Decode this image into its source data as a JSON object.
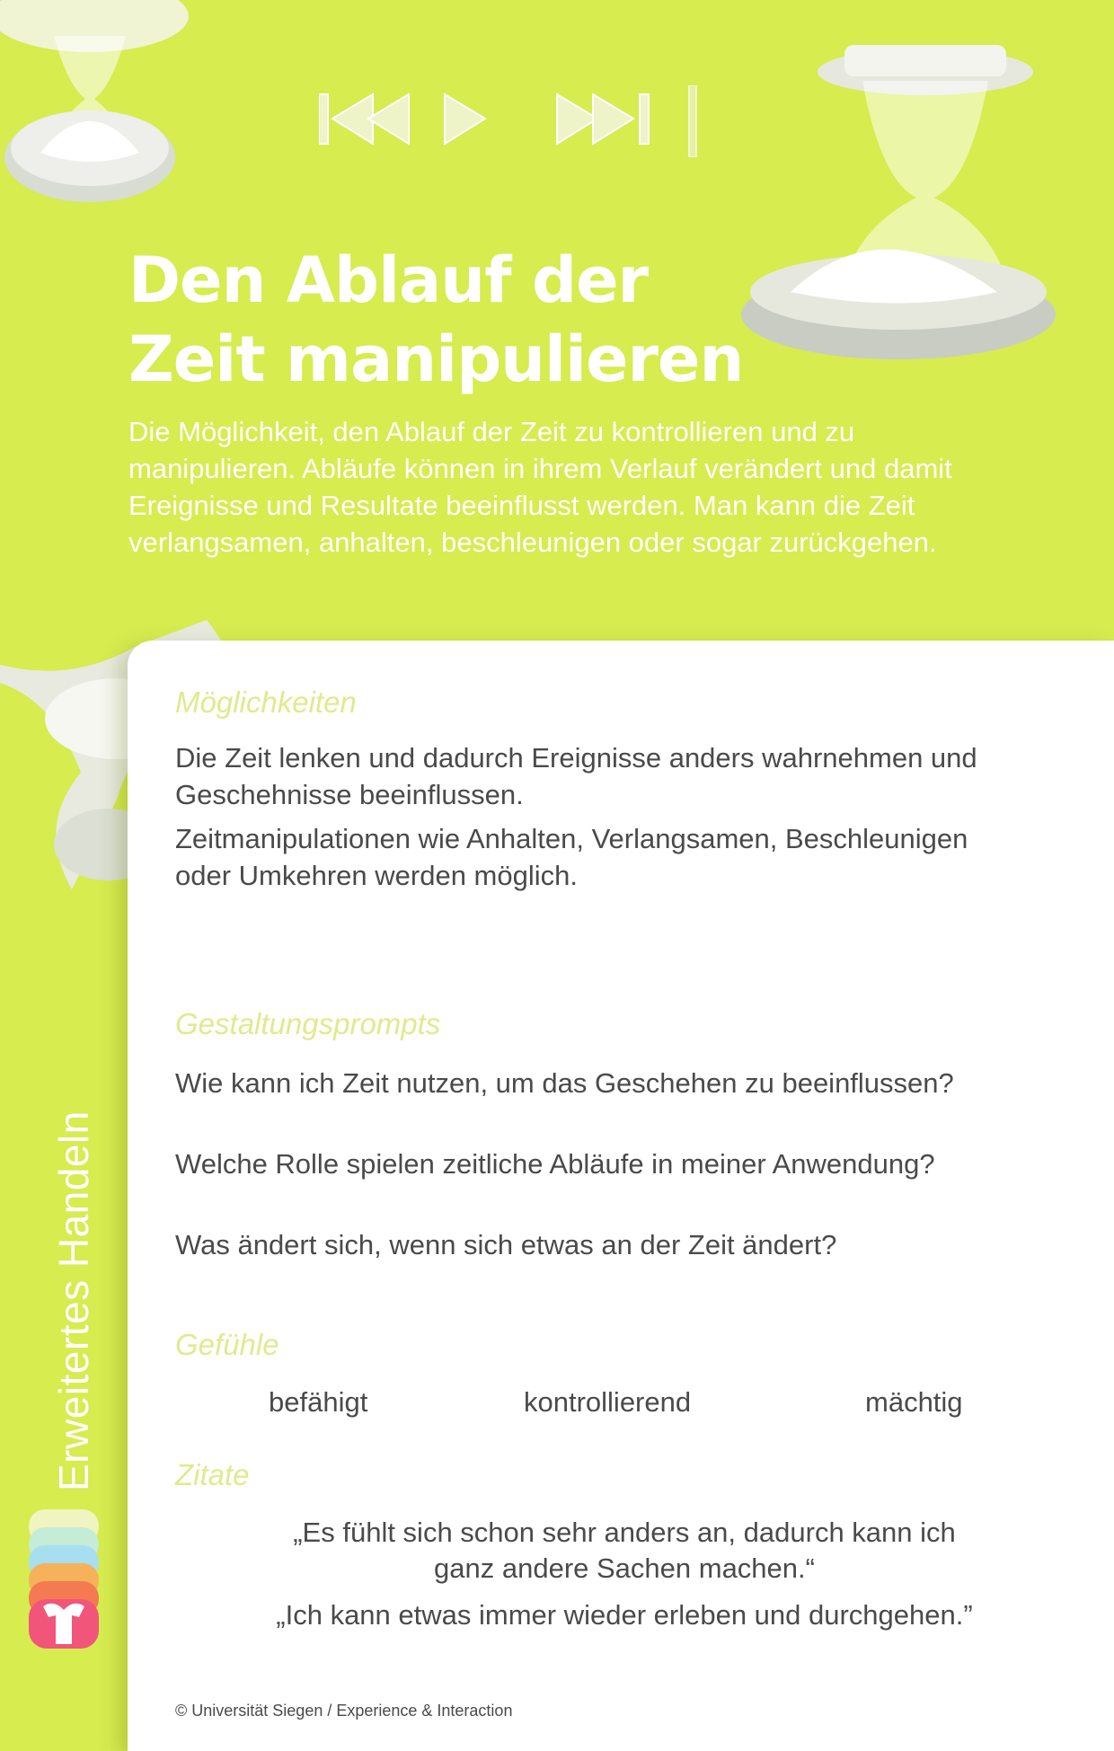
{
  "header": {
    "title_line1": "Den Ablauf der",
    "title_line2": "Zeit manipulieren",
    "intro_lines": [
      "Die Möglichkeit, den Ablauf der Zeit zu kontrollieren und zu",
      "manipulieren. Abläufe können in ihrem Verlauf verändert und damit",
      "Ereignisse und Resultate beeinflusst werden. Man kann die Zeit",
      "verlangsamen, anhalten, beschleunigen oder sogar zurückgehen."
    ]
  },
  "side_label": "Erweitertes Handeln",
  "sections": {
    "moeglichkeiten": {
      "heading": "Möglichkeiten",
      "p1_lines": [
        "Die Zeit lenken und dadurch Ereignisse anders wahrnehmen und",
        "Geschehnisse beeinflussen."
      ],
      "p2_lines": [
        "Zeitmanipulationen wie Anhalten, Verlangsamen, Beschleunigen",
        "oder Umkehren werden möglich."
      ]
    },
    "prompts": {
      "heading": "Gestaltungsprompts",
      "items": [
        "Wie kann ich Zeit nutzen, um das Geschehen zu beeinflussen?",
        "Welche Rolle spielen zeitliche Abläufe in meiner Anwendung?",
        "Was ändert sich, wenn sich etwas an der Zeit ändert?"
      ]
    },
    "gefuehle": {
      "heading": "Gefühle",
      "items": [
        "befähigt",
        "kontrollierend",
        "mächtig"
      ]
    },
    "zitate": {
      "heading": "Zitate",
      "quote1_lines": [
        "„Es fühlt sich schon sehr anders an, dadurch kann ich",
        "ganz andere Sachen machen.“"
      ],
      "quote2": "„Ich kann etwas immer wieder erleben und durchgehen.”"
    }
  },
  "footer": "© Universität Siegen / Experience & Interaction",
  "icons": [
    "hourglass-icon",
    "skip-back-icon",
    "play-icon",
    "skip-forward-icon",
    "app-logo-icon"
  ],
  "colors": {
    "background": "#d6ec4f",
    "card": "#ffffff",
    "heading_accent": "#e0ea8e",
    "body_text": "#4a4a4a",
    "logo_stripes": [
      "#f0f4c0",
      "#c5ecd6",
      "#a8dff0",
      "#f6b25a",
      "#f47a52",
      "#f2557a"
    ]
  }
}
